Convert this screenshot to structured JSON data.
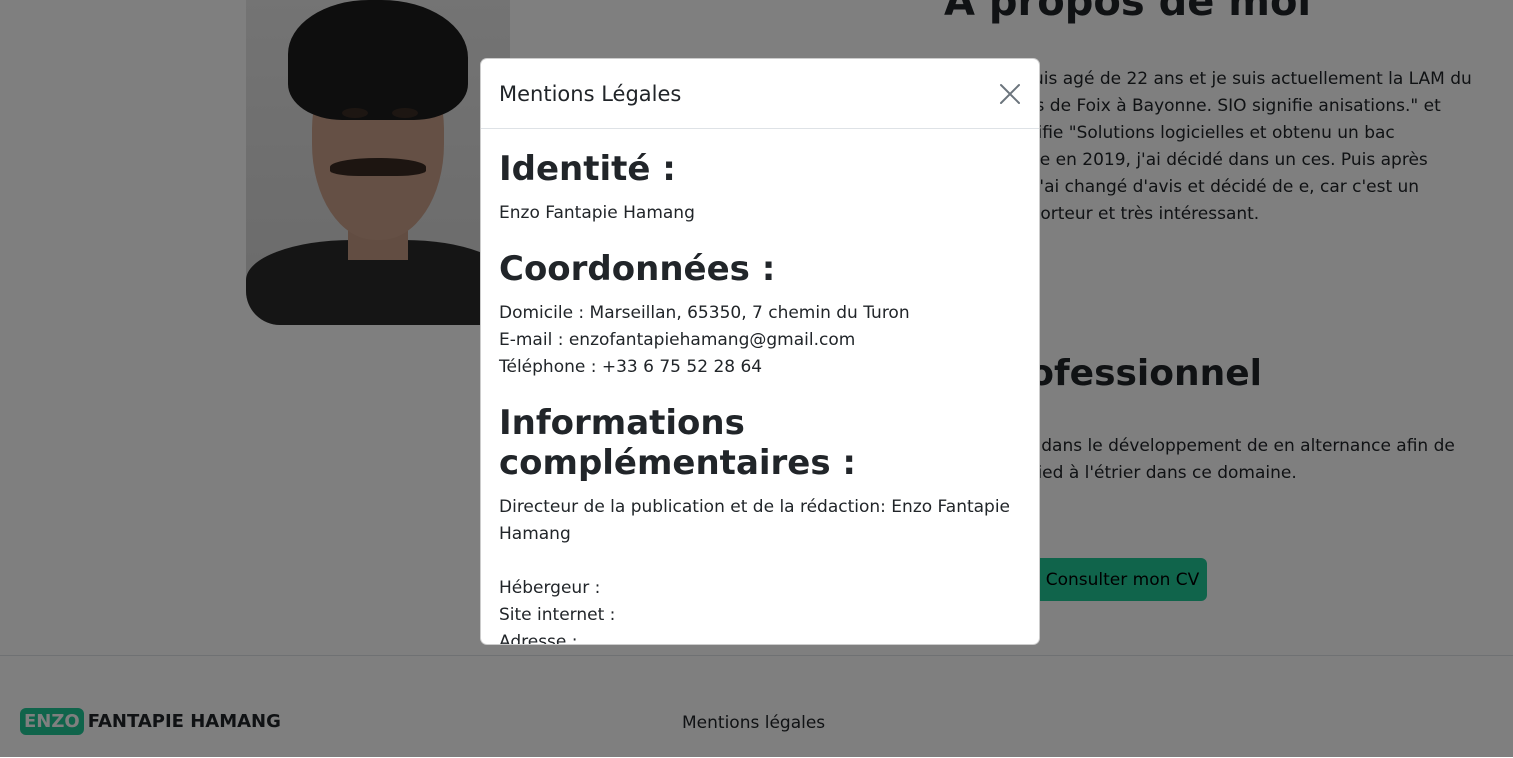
{
  "background": {
    "about_title": "À propos de moi",
    "about_text": "hang, je suis agé de 22 ans et je suis actuellement la LAM du lycée Louis de Foix à Bayonne. SIO signifie anisations.\" et SLAM signifie \"Solutions logicielles et obtenu un bac Scientifique en 2019, j'ai décidé dans un ces. Puis après réflexion, j'ai changé d'avis et décidé de e, car c'est un domaine porteur et très intéressant.",
    "pro_title": "t professionnel",
    "pro_text": "SIO, j'aimerais me spécialiser dans le développement de en alternance afin de mettre le pied à l'étrier dans ce domaine.",
    "cv_button": "Consulter mon CV",
    "accent_color": "#20c997"
  },
  "footer": {
    "brand_badge": "ENZO",
    "brand_name": "FANTAPIE HAMANG",
    "link": "Mentions légales"
  },
  "modal": {
    "title": "Mentions Légales",
    "identity_heading": "Identité :",
    "identity_text": "Enzo Fantapie Hamang",
    "contact_heading": "Coordonnées :",
    "contact_address": "Domicile : Marseillan, 65350, 7 chemin du Turon",
    "contact_email": "E-mail : enzofantapiehamang@gmail.com",
    "contact_phone": "Téléphone : +33 6 75 52 28 64",
    "info_heading": "Informations complémentaires :",
    "info_director": "Directeur de la publication et de la rédaction: Enzo Fantapie Hamang",
    "host_label": "Hébergeur :",
    "site_label": "Site internet :",
    "address_label": "Adresse :",
    "close_icon": "close-icon"
  }
}
